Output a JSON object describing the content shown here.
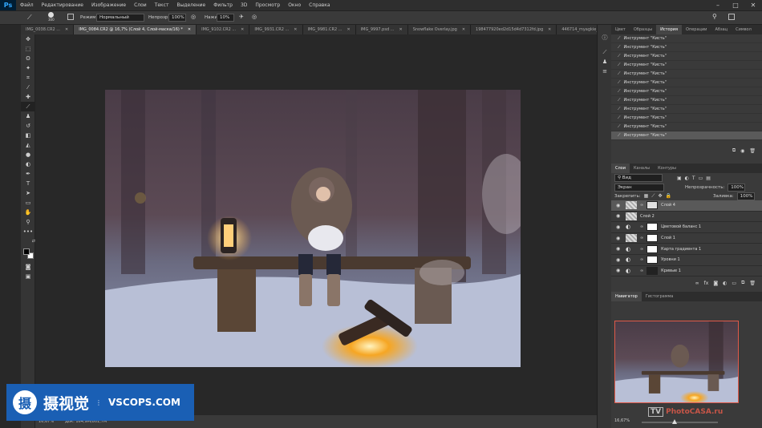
{
  "app": {
    "logo": "Ps"
  },
  "menu": [
    "Файл",
    "Редактирование",
    "Изображение",
    "Слои",
    "Текст",
    "Выделение",
    "Фильтр",
    "3D",
    "Просмотр",
    "Окно",
    "Справка"
  ],
  "options": {
    "brush_size": "300",
    "mode_label": "Режим:",
    "mode_value": "Нормальный",
    "opacity_label": "Непрозр.:",
    "opacity_value": "100%",
    "flow_label": "Нажим:",
    "flow_value": "10%"
  },
  "doc_tabs": [
    {
      "label": "IMG_0038.CR2 ...",
      "active": false
    },
    {
      "label": "IMG_0084.CR2 @ 16,7% (Слой 4, Слой-маска/16) *",
      "active": true
    },
    {
      "label": "IMG_9102.CR2 ...",
      "active": false
    },
    {
      "label": "IMG_9931.CR2 ...",
      "active": false
    },
    {
      "label": "IMG_9981.CR2 ...",
      "active": false
    },
    {
      "label": "IMG_9997.psd ...",
      "active": false
    },
    {
      "label": "Snowflake Overlay.jpg",
      "active": false
    },
    {
      "label": "198477920ed2d15d4d7312fd.jpg",
      "active": false
    },
    {
      "label": "446714_myagkie_legkie_sn",
      "active": false
    }
  ],
  "status": {
    "zoom": "16,67%",
    "doc": "Док: 164,9М/801,7М"
  },
  "history_panel": {
    "tabs": [
      "Цвет",
      "Образцы",
      "История",
      "Операции",
      "Абзац",
      "Символ"
    ],
    "active_tab": "История",
    "rows": [
      "Инструмент \"Кисть\"",
      "Инструмент \"Кисть\"",
      "Инструмент \"Кисть\"",
      "Инструмент \"Кисть\"",
      "Инструмент \"Кисть\"",
      "Инструмент \"Кисть\"",
      "Инструмент \"Кисть\"",
      "Инструмент \"Кисть\"",
      "Инструмент \"Кисть\"",
      "Инструмент \"Кисть\"",
      "Инструмент \"Кисть\"",
      "Инструмент \"Кисть\""
    ]
  },
  "layers_panel": {
    "tabs": [
      "Слои",
      "Каналы",
      "Контуры"
    ],
    "active_tab": "Слои",
    "filter": "Вид",
    "blend_mode": "Экран",
    "opacity_label": "Непрозрачность:",
    "opacity_value": "100%",
    "fill_label": "Заливка:",
    "fill_value": "100%",
    "lock_label": "Закрепить:",
    "layers": [
      {
        "name": "Слой 4",
        "selected": true
      },
      {
        "name": "Слой 2",
        "selected": false
      },
      {
        "name": "Цветовой баланс 1",
        "selected": false
      },
      {
        "name": "Слой 1",
        "selected": false
      },
      {
        "name": "Карта градиента 1",
        "selected": false
      },
      {
        "name": "Уровни 1",
        "selected": false
      },
      {
        "name": "Кривые 1",
        "selected": false
      }
    ]
  },
  "navigator": {
    "tabs": [
      "Навигатор",
      "Гистограмма"
    ],
    "active_tab": "Навигатор",
    "zoom": "16,67%"
  },
  "watermark": {
    "cn": "摄视觉",
    "en": "VSCOPS.COM",
    "logo": "摄",
    "tv": "TV",
    "photocasa": "PhotoCASA.ru"
  },
  "colors": {
    "brand_blue": "#1a5fb4",
    "ps_blue": "#31a8ff"
  }
}
